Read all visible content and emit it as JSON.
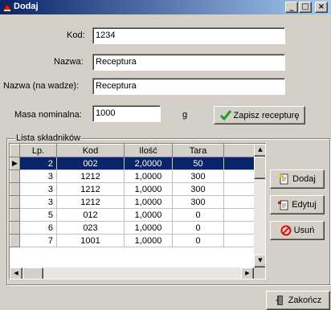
{
  "window": {
    "title": "Dodaj",
    "minimize": "_",
    "maximize": "□",
    "close": "×"
  },
  "form": {
    "kod_label": "Kod:",
    "kod_value": "1234",
    "nazwa_label": "Nazwa:",
    "nazwa_value": "Receptura",
    "nazwa_wadze_label": "Nazwa (na wadze):",
    "nazwa_wadze_value": "Receptura",
    "masa_label": "Masa nominalna:",
    "masa_value": "1000",
    "masa_unit": "g",
    "zapisz_label": "Zapisz recepturę"
  },
  "lista": {
    "title": "Lista składników",
    "columns": [
      "Lp.",
      "Kod",
      "Ilość",
      "Tara"
    ],
    "selected_marker": "▶",
    "rows": [
      {
        "lp": "2",
        "kod": "002",
        "ilosc": "2,0000",
        "tara": "50"
      },
      {
        "lp": "3",
        "kod": "1212",
        "ilosc": "1,0000",
        "tara": "300"
      },
      {
        "lp": "3",
        "kod": "1212",
        "ilosc": "1,0000",
        "tara": "300"
      },
      {
        "lp": "3",
        "kod": "1212",
        "ilosc": "1,0000",
        "tara": "300"
      },
      {
        "lp": "5",
        "kod": "012",
        "ilosc": "1,0000",
        "tara": "0"
      },
      {
        "lp": "6",
        "kod": "023",
        "ilosc": "1,0000",
        "tara": "0"
      },
      {
        "lp": "7",
        "kod": "1001",
        "ilosc": "1,0000",
        "tara": "0"
      }
    ]
  },
  "buttons": {
    "dodaj": "Dodaj",
    "edytuj": "Edytuj",
    "usun": "Usuń",
    "zakoncz": "Zakończ"
  },
  "scroll": {
    "up": "▲",
    "down": "▼",
    "left": "◀",
    "right": "▶"
  },
  "colors": {
    "title_start": "#0a246a",
    "title_end": "#a6caf0",
    "selection": "#0a246a",
    "face": "#d4d0c8",
    "check_green": "#1e9e1e",
    "usun_red": "#e01010"
  }
}
